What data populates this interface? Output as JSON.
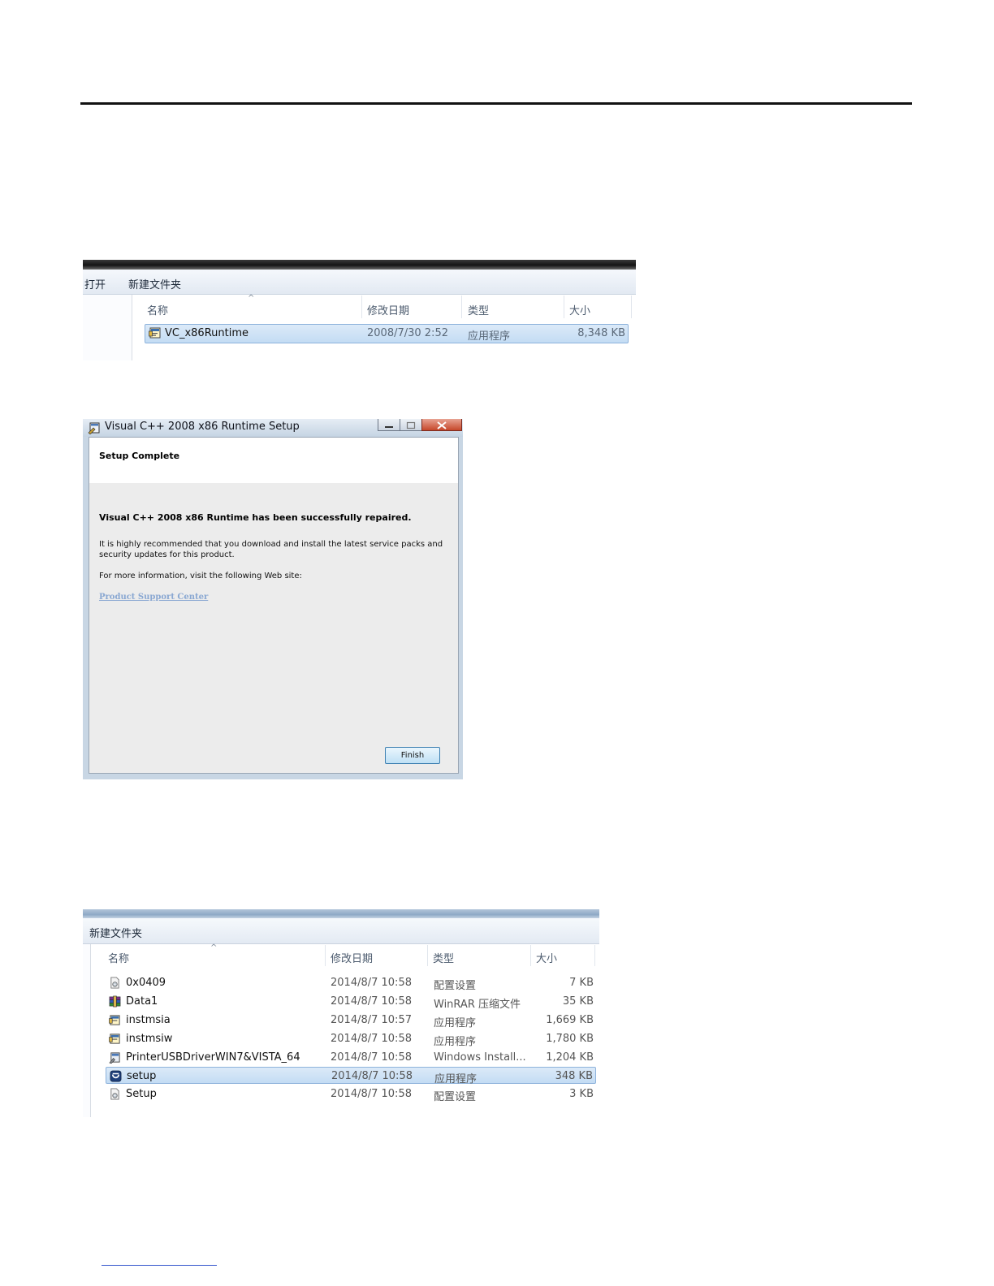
{
  "explorer1": {
    "toolbar": {
      "open": "打开",
      "new_folder": "新建文件夹"
    },
    "columns": {
      "name": "名称",
      "date": "修改日期",
      "type": "类型",
      "size": "大小"
    },
    "file": {
      "name": "VC_x86Runtime",
      "date": "2008/7/30 2:52",
      "type": "应用程序",
      "size": "8,348 KB",
      "icon": "installer-icon"
    }
  },
  "dialog": {
    "title": "Visual C++ 2008 x86 Runtime Setup",
    "header": "Setup Complete",
    "message_bold": "Visual C++ 2008 x86 Runtime has been successfully repaired.",
    "message_line1": "It is highly recommended that you download and install the latest service packs and",
    "message_line2": "security updates for this product.",
    "info": "For more information, visit the following Web site:",
    "link": "Product Support Center",
    "finish": "Finish"
  },
  "explorer2": {
    "toolbar": {
      "new_folder": "新建文件夹"
    },
    "columns": {
      "name": "名称",
      "date": "修改日期",
      "type": "类型",
      "size": "大小"
    },
    "files": [
      {
        "name": "0x0409",
        "date": "2014/8/7 10:58",
        "type": "配置设置",
        "size": "7 KB",
        "icon": "settings-file-icon"
      },
      {
        "name": "Data1",
        "date": "2014/8/7 10:58",
        "type": "WinRAR 压缩文件",
        "size": "35 KB",
        "icon": "archive-icon"
      },
      {
        "name": "instmsia",
        "date": "2014/8/7 10:57",
        "type": "应用程序",
        "size": "1,669 KB",
        "icon": "installer-icon"
      },
      {
        "name": "instmsiw",
        "date": "2014/8/7 10:58",
        "type": "应用程序",
        "size": "1,780 KB",
        "icon": "installer-icon"
      },
      {
        "name": "PrinterUSBDriverWIN7&VISTA_64",
        "date": "2014/8/7 10:58",
        "type": "Windows Install...",
        "size": "1,204 KB",
        "icon": "msi-package-icon"
      },
      {
        "name": "setup",
        "date": "2014/8/7 10:58",
        "type": "应用程序",
        "size": "348 KB",
        "icon": "setup-app-icon"
      },
      {
        "name": "Setup",
        "date": "2014/8/7 10:58",
        "type": "配置设置",
        "size": "3 KB",
        "icon": "settings-file-icon"
      }
    ],
    "selected_index": 5
  },
  "colors": {
    "selection_fill": "#c3dcf4",
    "selection_border": "#8db2db",
    "link": "#8aa8d2",
    "rule": "#111111"
  }
}
